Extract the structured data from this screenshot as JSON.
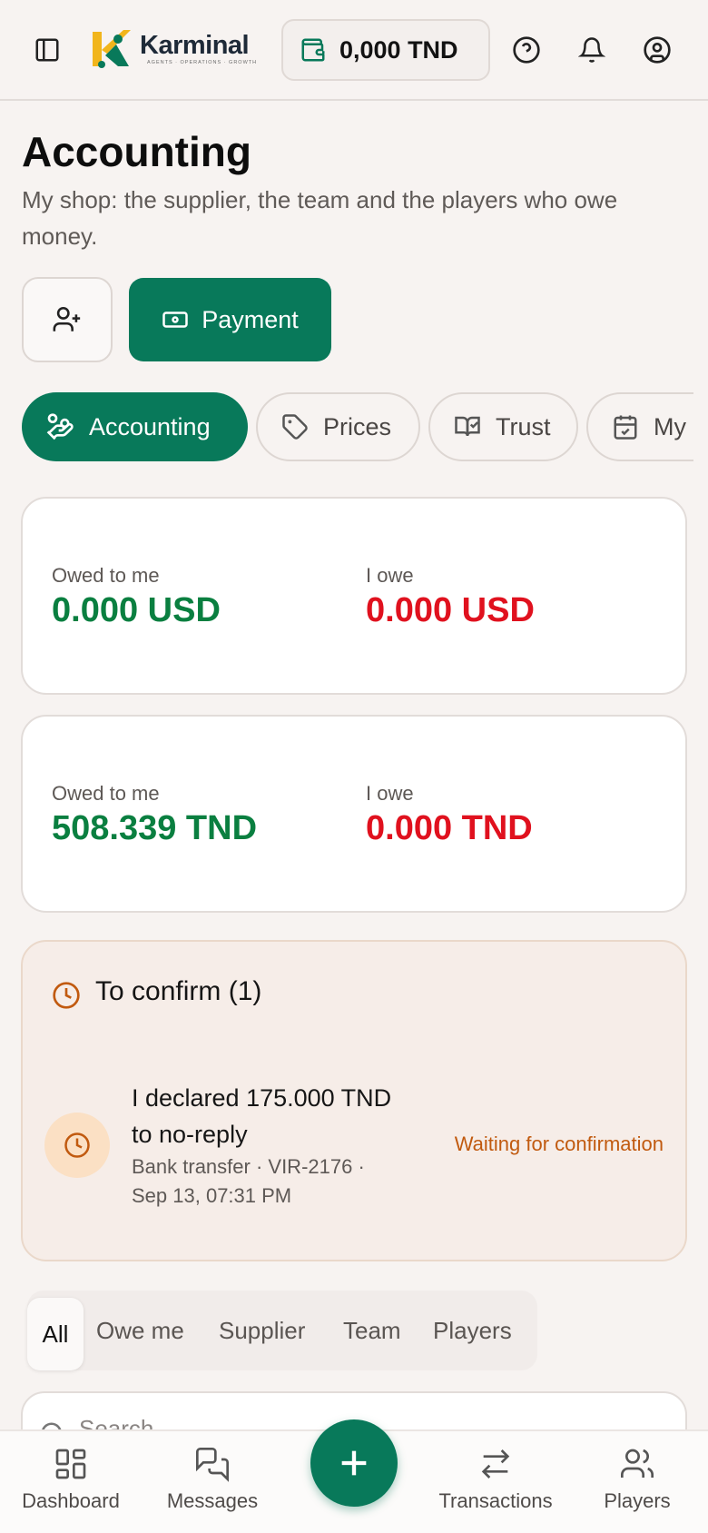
{
  "header": {
    "brand_name": "Karminal",
    "brand_tagline": "AGENTS · OPERATIONS · GROWTH",
    "balance": "0,000 TND"
  },
  "page": {
    "title": "Accounting",
    "subtitle": "My shop: the supplier, the team and the players who owe money."
  },
  "actions": {
    "payment_label": "Payment"
  },
  "categories": [
    {
      "label": "Accounting",
      "icon": "hand-coins-icon"
    },
    {
      "label": "Prices",
      "icon": "tag-icon"
    },
    {
      "label": "Trust",
      "icon": "book-check-icon"
    },
    {
      "label": "My",
      "icon": "calendar-check-icon"
    }
  ],
  "balances": [
    {
      "owed_label": "Owed to me",
      "owed_value": "0.000 USD",
      "owe_label": "I owe",
      "owe_value": "0.000 USD"
    },
    {
      "owed_label": "Owed to me",
      "owed_value": "508.339 TND",
      "owe_label": "I owe",
      "owe_value": "0.000 TND"
    }
  ],
  "to_confirm": {
    "title": "To confirm (1)",
    "item": {
      "title": "I declared 175.000 TND to no-reply",
      "meta": "Bank transfer · VIR-2176 · Sep 13, 07:31 PM",
      "status": "Waiting for confirmation"
    }
  },
  "filters": [
    "All",
    "Owe me",
    "Supplier",
    "Team",
    "Players"
  ],
  "search": {
    "placeholder": "Search"
  },
  "nav": [
    {
      "label": "Dashboard",
      "icon": "dashboard-icon"
    },
    {
      "label": "Messages",
      "icon": "messages-icon"
    },
    {
      "label": "Transactions",
      "icon": "transactions-icon"
    },
    {
      "label": "Players",
      "icon": "players-icon"
    }
  ],
  "colors": {
    "primary": "#08795a",
    "positive": "#0a7f40",
    "negative": "#e0111e",
    "pending": "#c15a0f"
  }
}
